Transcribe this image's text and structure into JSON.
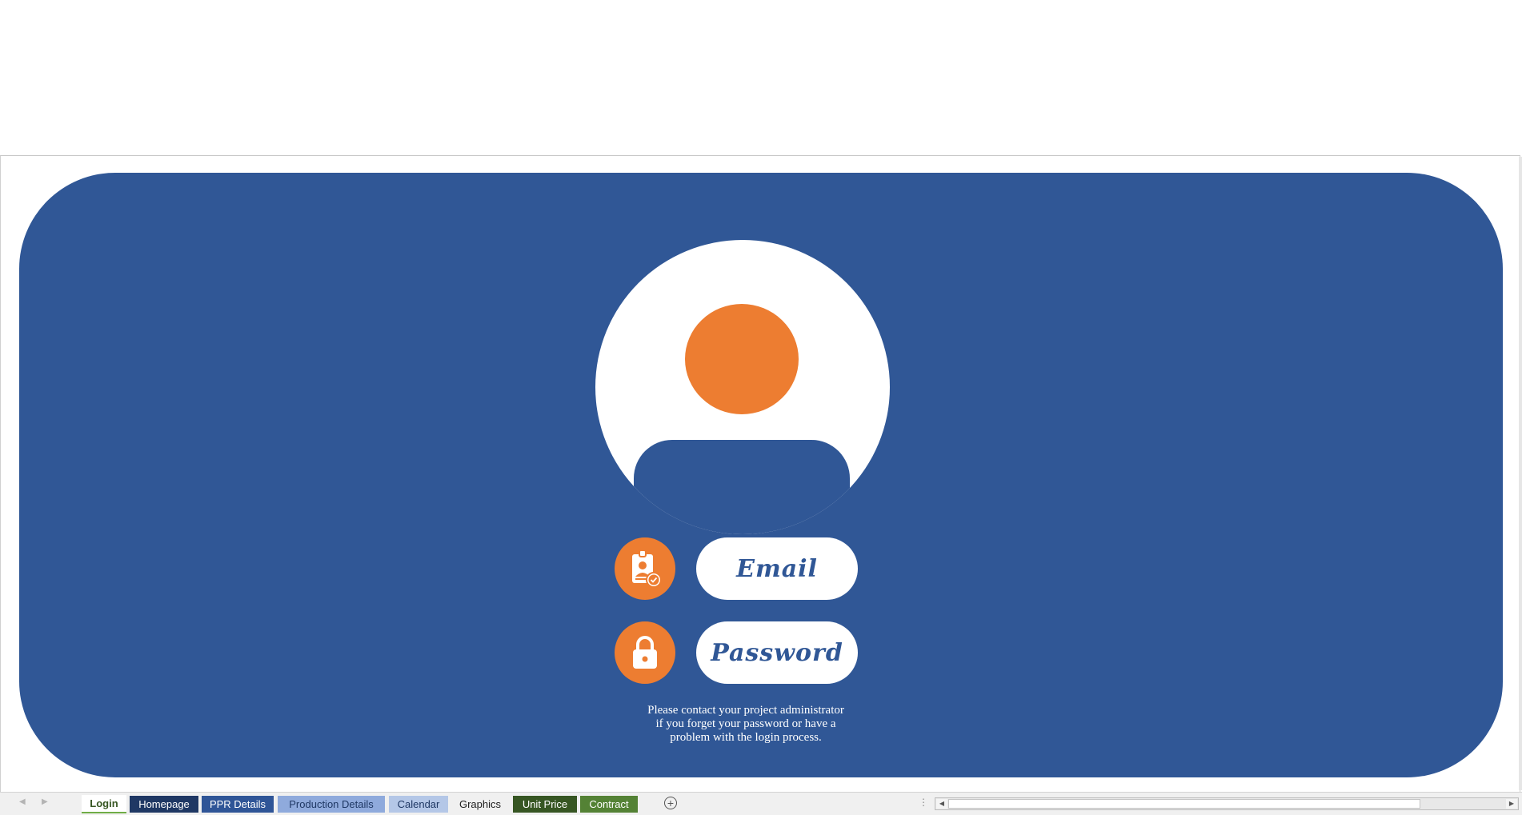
{
  "login": {
    "email_label": "Email",
    "password_label": "Password",
    "help_lines": [
      "Please contact your project administrator",
      "if you forget your password or have a",
      "problem with the login process."
    ]
  },
  "tabs": [
    {
      "label": "Login",
      "bg": "#ffffff",
      "fg": "#375623"
    },
    {
      "label": "Homepage",
      "bg": "#1f3864",
      "fg": "#ffffff"
    },
    {
      "label": "PPR Details",
      "bg": "#2f5597",
      "fg": "#ffffff"
    },
    {
      "label": "Production Details",
      "bg": "#8faadc",
      "fg": "#1f3864"
    },
    {
      "label": "Calendar",
      "bg": "#b4c7e7",
      "fg": "#1f3864"
    },
    {
      "label": "Graphics",
      "bg": "#f0f0f0",
      "fg": "#222222"
    },
    {
      "label": "Unit Price",
      "bg": "#375623",
      "fg": "#ffffff"
    },
    {
      "label": "Contract",
      "bg": "#548235",
      "fg": "#ffffff"
    }
  ],
  "colors": {
    "panel": "#305796",
    "accent": "#ed7d31",
    "active_tab_underline": "#70ad47"
  },
  "icons": {
    "email_icon": "id-badge-check-icon",
    "password_icon": "padlock-icon",
    "avatar": "user-avatar-icon"
  }
}
